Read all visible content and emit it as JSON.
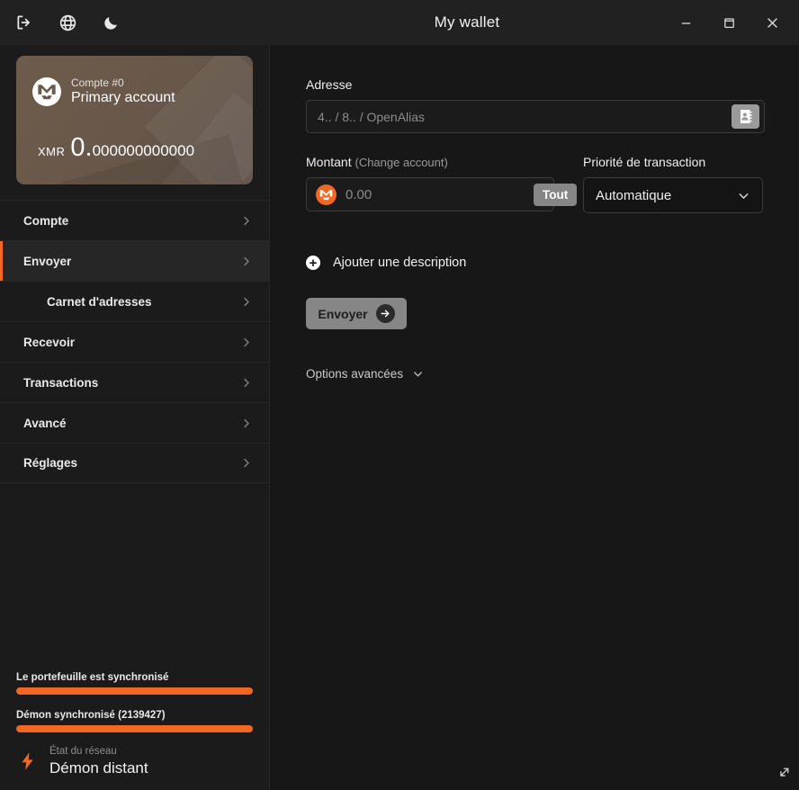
{
  "window": {
    "title": "My wallet",
    "controls": {
      "minimize": "minimize-icon",
      "maximize": "maximize-icon",
      "close": "close-icon"
    },
    "left_icons": [
      {
        "name": "logout-icon",
        "label": "Logout"
      },
      {
        "name": "globe-icon",
        "label": "Language"
      },
      {
        "name": "moon-icon",
        "label": "Theme"
      }
    ]
  },
  "colors": {
    "accent": "#f26822",
    "window_bg": "#212121",
    "sidebar_bg": "#1b1b1b",
    "main_bg": "#171717",
    "card_start": "#6d5b4c",
    "card_end": "#5e5048",
    "button_gray": "#868686",
    "border": "#3b3b3b"
  },
  "sidebar": {
    "account_card": {
      "number": "Compte #0",
      "name": "Primary account",
      "currency": "XMR",
      "balance_integer": "0.",
      "balance_decimals": "000000000000",
      "logo": "monero-logo"
    },
    "items": [
      {
        "label": "Compte",
        "active": false,
        "sub": false
      },
      {
        "label": "Envoyer",
        "active": true,
        "sub": false
      },
      {
        "label": "Carnet d'adresses",
        "active": false,
        "sub": true
      },
      {
        "label": "Recevoir",
        "active": false,
        "sub": false
      },
      {
        "label": "Transactions",
        "active": false,
        "sub": false
      },
      {
        "label": "Avancé",
        "active": false,
        "sub": false
      },
      {
        "label": "Réglages",
        "active": false,
        "sub": false
      }
    ],
    "status": {
      "wallet_sync_text": "Le portefeuille est synchronisé",
      "wallet_sync_percent": 100,
      "daemon_sync_text": "Démon synchronisé (2139427)",
      "daemon_sync_percent": 100,
      "network_caption": "État du réseau",
      "network_value": "Démon distant"
    }
  },
  "main": {
    "address": {
      "label": "Adresse",
      "value": "",
      "placeholder": "4.. / 8.. / OpenAlias",
      "button_icon": "address-book-icon"
    },
    "amount": {
      "label": "Montant",
      "label_suffix": "(Change account)",
      "value": "",
      "placeholder": "0.00",
      "max_button_label": "Tout"
    },
    "priority": {
      "label": "Priorité de transaction",
      "selected": "Automatique"
    },
    "add_description_label": "Ajouter une description",
    "send_button_label": "Envoyer",
    "advanced_options_label": "Options avancées"
  }
}
